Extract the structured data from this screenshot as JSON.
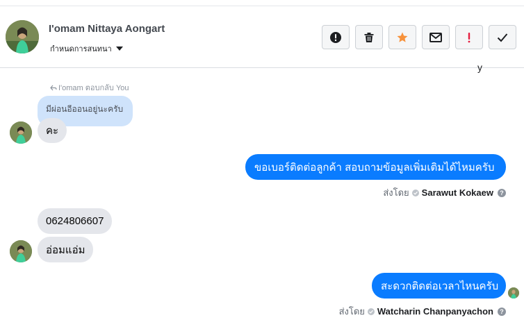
{
  "header": {
    "contact_name": "I'omam Nittaya Aongart",
    "assign_label": "กำหนดการสนทนา",
    "actions": [
      {
        "name": "spam-button",
        "icon": "exclamation-circle-icon"
      },
      {
        "name": "delete-button",
        "icon": "trash-icon"
      },
      {
        "name": "star-button",
        "icon": "star-icon",
        "color": "#f7923b"
      },
      {
        "name": "mark-unread-button",
        "icon": "envelope-icon"
      },
      {
        "name": "follow-up-button",
        "icon": "exclamation-icon",
        "color": "#e41e3f"
      },
      {
        "name": "mark-done-button",
        "icon": "checkmark-icon"
      }
    ]
  },
  "chat": {
    "partial_top_text": "y",
    "reply_label": "I'omam ตอบกลับ You",
    "quoted_message": "มีผ่อนอีออนอยู่นะครับ",
    "messages": {
      "m1": "คะ",
      "m2": "ขอเบอร์ติดต่อลูกค้า สอบถามข้อมูลเพิ่มเติมได้ไหมครับ",
      "m3": "0624806607",
      "m4": "อ่อมแอ่ม",
      "m5": "สะดวกติดต่อเวลาไหนครับ"
    },
    "sent_by_label": "ส่งโดย",
    "sent_by_1": "Sarawut Kokaew",
    "sent_by_2": "Watcharin Chanpanyachon",
    "help_symbol": "?",
    "outgoing_color": "#0a7cff",
    "incoming_color": "#e4e6eb",
    "quoted_color": "#cfe3fb"
  }
}
